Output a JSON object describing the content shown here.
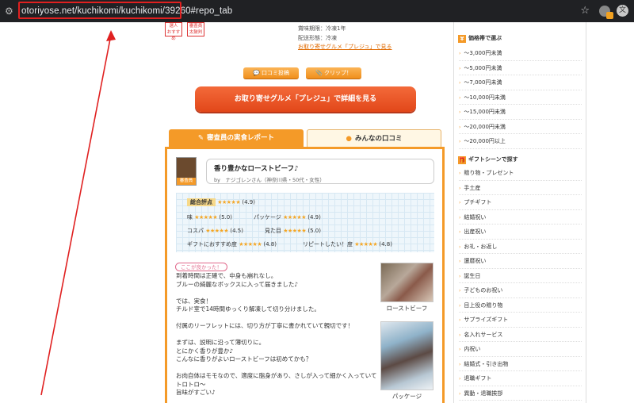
{
  "browser": {
    "url": "otoriyose.net/kuchikomi/kuchikomi/39260#repo_tab"
  },
  "product": {
    "badges": [
      {
        "line1": "選人",
        "line2": "おすすめ"
      },
      {
        "line1": "審査員",
        "line2": "太鼓判"
      }
    ],
    "expiry": "賞味期限：冷凍1年",
    "delivery": "配送形態：冷凍",
    "gourmet_link": "お取り寄せグルメ「プレジュ」で見る",
    "kuchikomi_button": "口コミ投稿",
    "clip_button": "クリップ！",
    "cta_button": "お取り寄せグルメ「プレジュ」で詳細を見る"
  },
  "tabs": {
    "report": "審査員の実食レポート",
    "kuchikomi": "みんなの口コミ"
  },
  "review": {
    "avatar_label": "審査員",
    "title": "香り豊かなローストビーフ♪",
    "author": "by　ナジゴレンさん（神奈川県・50代・女性）",
    "ratings": {
      "total_label": "総合評点",
      "total_stars": "★★★★★",
      "total_score": "(4.9)",
      "taste_label": "味",
      "taste_stars": "★★★★★",
      "taste_score": "(5.0)",
      "package_label": "パッケージ",
      "package_stars": "★★★★★",
      "package_score": "(4.9)",
      "cospa_label": "コスパ",
      "cospa_stars": "★★★★★",
      "cospa_score": "(4.5)",
      "looks_label": "見た目",
      "looks_stars": "★★★★★",
      "looks_score": "(5.0)",
      "gift_label": "ギフトにおすすめ度",
      "gift_stars": "★★★★★",
      "gift_score": "(4.8)",
      "repeat_label": "リピートしたい！度",
      "repeat_stars": "★★★★★",
      "repeat_score": "(4.8)"
    },
    "good_point_tag": "ここが良かった！",
    "body": "到着時間は正確で、中身も崩れなし。\nブルーの綺麗なボックスに入って届きました♪\n\nでは、実食！\nチルド室で14時間ゆっくり解凍して切り分けました。\n\n付属のリーフレットには、切り方が丁寧に書かれていて親切です！\n\nまずは、説明に沿って薄切りに。\nとにかく香りが豊か♪\nこんなに香りがよいローストビーフは初めてかも？\n\nお肉自体はモモなので、適度に脂身があり、さしが入って細かく入っていてトロトロ～\n旨味がすごい♪",
    "photo1_caption": "ローストビーフ",
    "photo2_caption": "パッケージ"
  },
  "sidebar": {
    "price_heading": "価格帯で選ぶ",
    "price_items": [
      "～3,000円未満",
      "～5,000円未満",
      "～7,000円未満",
      "～10,000円未満",
      "～15,000円未満",
      "～20,000円未満",
      "～20,000円以上"
    ],
    "gift_heading": "ギフトシーンで探す",
    "gift_items": [
      "贈り物・プレゼント",
      "手土産",
      "プチギフト",
      "結婚祝い",
      "出産祝い",
      "お礼・お返し",
      "還暦祝い",
      "誕生日",
      "子どものお祝い",
      "目上役の贈り物",
      "サプライズギフト",
      "名入れサービス",
      "内祝い",
      "結婚式・引き出物",
      "退職ギフト",
      "異動・退職挨拶"
    ]
  },
  "colors": {
    "accent_orange": "#f49a28",
    "cta_red": "#e2471a",
    "highlight_red": "#e02020"
  }
}
